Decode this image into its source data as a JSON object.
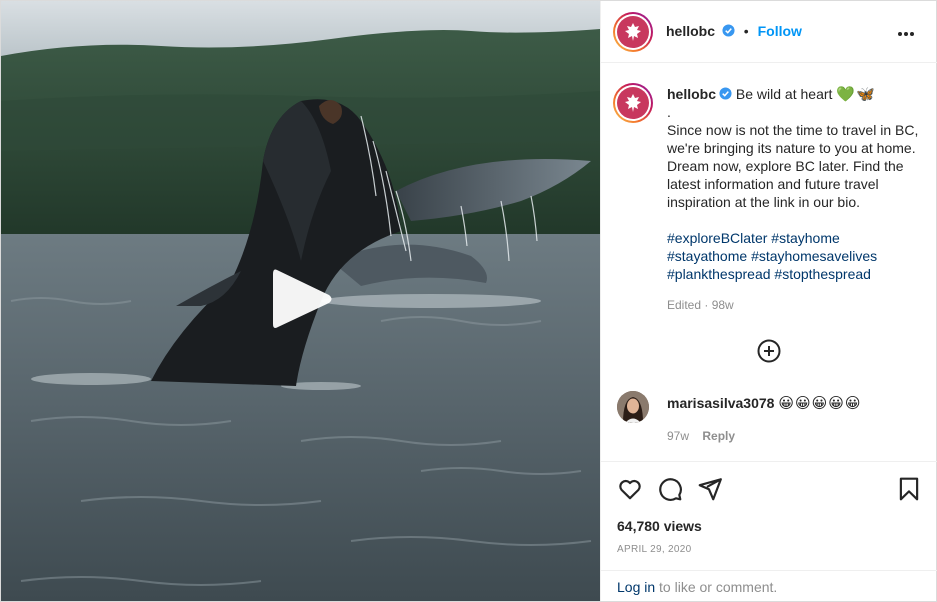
{
  "post": {
    "username": "hellobc",
    "follow_label": "Follow",
    "dot": "•",
    "caption_headline": "Be wild at heart",
    "caption_emojis": "💚🦋",
    "caption_dot": ".",
    "caption_body": "Since now is not the time to travel in BC, we're bringing its nature to you at home. Dream now, explore BC later. Find the latest information and future travel inspiration at the link in our bio.",
    "hashtags": [
      "#exploreBClater",
      "#stayhome",
      "#stayathome",
      "#stayhomesavelives",
      "#plankthespread",
      "#stopthespread"
    ],
    "edited": "Edited · 98w"
  },
  "comment": {
    "username": "marisasilva3078",
    "text": "😀😀😀😀😀",
    "age": "97w",
    "reply_label": "Reply"
  },
  "stats": {
    "views": "64,780 views",
    "date": "APRIL 29, 2020"
  },
  "login": {
    "link": "Log in",
    "rest": " to like or comment."
  },
  "icons": {
    "play": "play-icon",
    "more": "more-options-icon",
    "verified": "verified-badge-icon",
    "add": "add-circle-icon",
    "like": "heart-icon",
    "comment": "comment-icon",
    "share": "share-icon",
    "save": "bookmark-icon"
  },
  "colors": {
    "follow": "#0095f6",
    "hashtag": "#00376b",
    "meta": "#8e8e8e",
    "verified": "#3897f0"
  }
}
